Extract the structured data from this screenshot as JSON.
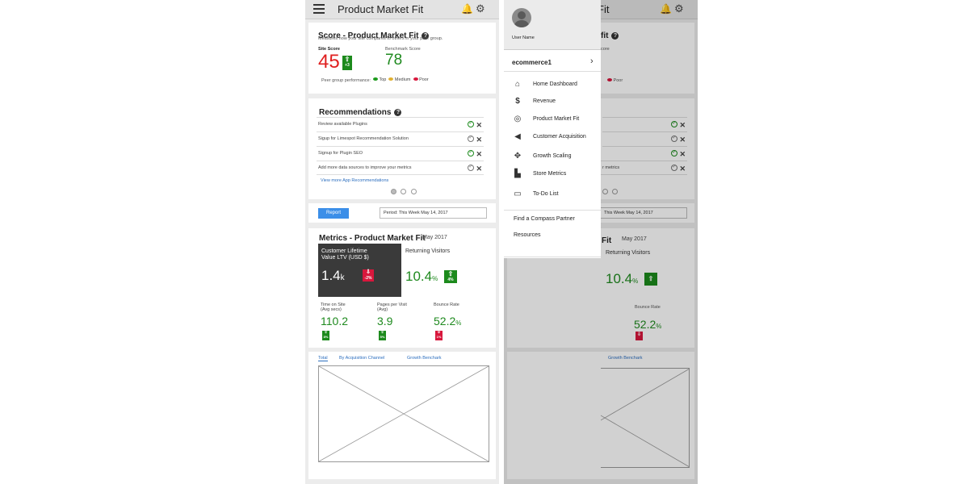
{
  "header": {
    "title": "Product Market Fit",
    "bell_icon": "bell-icon",
    "settings_icon": "gears-icon",
    "menu_icon": "hamburger-icon"
  },
  "score": {
    "title": "Score - Product Market Fit",
    "description": "Measures how your site compares to others in your peer group.",
    "site_score_label": "Site Score",
    "site_score": "45",
    "site_score_change": "+3",
    "benchmark_label": "Benchmark Score",
    "benchmark": "78",
    "peer_label": "Peer group performance:",
    "legend": [
      {
        "label": "Top",
        "color": "#1c9a1c"
      },
      {
        "label": "Medium",
        "color": "#e0b030"
      },
      {
        "label": "Poor",
        "color": "#d8173c"
      }
    ]
  },
  "recommendations": {
    "title": "Recommendations",
    "items": [
      {
        "text": "Review available Plugins",
        "status": "done"
      },
      {
        "text": "Sigup for Limespot Recommendation Solution",
        "status": "pending"
      },
      {
        "text": "Signup for Plugin SEO",
        "status": "done"
      },
      {
        "text": "Add more data sources to improve your metrics",
        "status": "pending"
      }
    ],
    "link": "View  more App Recommendations"
  },
  "report": {
    "button": "Report",
    "period": "Period:    This Week May 14, 2017"
  },
  "metrics": {
    "title": "Metrics - Product Market Fit",
    "date": "May 2017",
    "ltv": {
      "label1": "Customer Lifetime",
      "label2": "Value LTV (USD $)",
      "value": "1.4",
      "unit": "k",
      "change": "-2%"
    },
    "returning": {
      "label": "Returning Visitors",
      "value": "10.4",
      "unit": "%",
      "change": "4%"
    },
    "time_on_site": {
      "label1": "Time on Site",
      "label2": "(Avg secs)",
      "value": "110.2",
      "change": "8%"
    },
    "pages_per_visit": {
      "label1": "Pages per Visit",
      "label2": "(Avg)",
      "value": "3.9",
      "change": "5%"
    },
    "bounce_rate": {
      "label1": "Bounce Rate",
      "label2": "",
      "value": "52.2",
      "unit": "%",
      "change": "1%"
    }
  },
  "tabs": [
    "Total",
    "By Acquisition Channel",
    "Growth Benchark"
  ],
  "drawer": {
    "user_name": "User Name",
    "store": "ecommerce1",
    "items": [
      {
        "label": "Home Dashboard",
        "icon": "home-icon"
      },
      {
        "label": "Revenue",
        "icon": "dollar-icon"
      },
      {
        "label": "Product Market Fit",
        "icon": "target-icon"
      },
      {
        "label": "Customer Acquisition",
        "icon": "megaphone-icon"
      },
      {
        "label": "Growth Scaling",
        "icon": "arrows-icon"
      },
      {
        "label": "Store  Metrics",
        "icon": "factory-icon"
      },
      {
        "label": "To-Do List",
        "icon": "inbox-icon"
      }
    ],
    "links": [
      "Find a Compass Partner",
      "Resources"
    ]
  },
  "bg_screen": {
    "title_fragment": "Fit",
    "metrics_fragment": "Fit",
    "date": "May 2017",
    "returning": "Returning Visitors",
    "returning_value": "10.4",
    "bounce_label": "Bounce Rate",
    "bounce_value": "52.2",
    "period": "This Week May 14, 2017",
    "peer_poor": "Poor",
    "rec_metrics_fragment": "r metrics",
    "score_fragment": "core",
    "tab": "Growth Benchark",
    "fit_fragment": "fit"
  }
}
